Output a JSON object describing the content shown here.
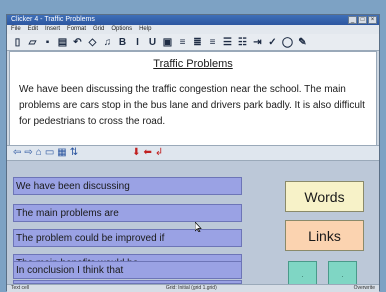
{
  "window": {
    "title": "Clicker 4 - Traffic Problems"
  },
  "menu": [
    "File",
    "Edit",
    "Insert",
    "Format",
    "Grid",
    "Options",
    "Help"
  ],
  "toolbar": {
    "items": [
      {
        "name": "new-doc-icon",
        "glyph": "▯"
      },
      {
        "name": "open-icon",
        "glyph": "▱"
      },
      {
        "name": "save-icon",
        "glyph": "▪"
      },
      {
        "name": "print-icon",
        "glyph": "▤"
      },
      {
        "name": "undo-icon",
        "glyph": "↶"
      },
      {
        "name": "clear-icon",
        "glyph": "◇"
      },
      {
        "name": "speak-icon",
        "glyph": "♫"
      },
      {
        "name": "bold-button",
        "glyph": "B"
      },
      {
        "name": "italic-button",
        "glyph": "I"
      },
      {
        "name": "underline-button",
        "glyph": "U"
      },
      {
        "name": "picture-icon",
        "glyph": "▣"
      },
      {
        "name": "align-left-icon",
        "glyph": "≡"
      },
      {
        "name": "align-center-icon",
        "glyph": "≣"
      },
      {
        "name": "align-right-icon",
        "glyph": "≡"
      },
      {
        "name": "bullets-icon",
        "glyph": "☰"
      },
      {
        "name": "numbering-icon",
        "glyph": "☷"
      },
      {
        "name": "indent-icon",
        "glyph": "⇥"
      },
      {
        "name": "spellcheck-icon",
        "glyph": "✓"
      },
      {
        "name": "speech-bubble-icon",
        "glyph": "◯"
      },
      {
        "name": "pen-icon",
        "glyph": "✎"
      }
    ]
  },
  "document": {
    "title": "Traffic Problems",
    "body": "We have been discussing the traffic congestion near the school.  The main problems are cars stop in the bus lane and drivers park badly.  It is also difficult for pedestrians to cross the road."
  },
  "grid_toolbar": [
    {
      "name": "back-arrow-icon",
      "glyph": "⇦",
      "red": false
    },
    {
      "name": "forward-arrow-icon",
      "glyph": "⇨",
      "red": false
    },
    {
      "name": "home-icon",
      "glyph": "⌂",
      "red": false
    },
    {
      "name": "folder-icon",
      "glyph": "▭",
      "red": false
    },
    {
      "name": "grid-view-icon",
      "glyph": "▦",
      "red": false
    },
    {
      "name": "sort-icon",
      "glyph": "⇅",
      "red": false
    },
    {
      "name": "gap",
      "glyph": "",
      "red": false
    },
    {
      "name": "red-down-icon",
      "glyph": "⬇",
      "red": true
    },
    {
      "name": "red-left-icon",
      "glyph": "⬅",
      "red": true
    },
    {
      "name": "red-return-icon",
      "glyph": "↲",
      "red": true
    }
  ],
  "phrases": [
    "We have been discussing",
    "The main problems are",
    "The problem could be improved if",
    "The main benefits would be",
    "In conclusion I think that"
  ],
  "side_buttons": {
    "words": "Words",
    "links": "Links",
    "small_left": ".",
    "small_right": "."
  },
  "status": {
    "left": "Text cell",
    "middle": "Grid: Initial (grid 1.grid)",
    "right": "Overwrite"
  }
}
